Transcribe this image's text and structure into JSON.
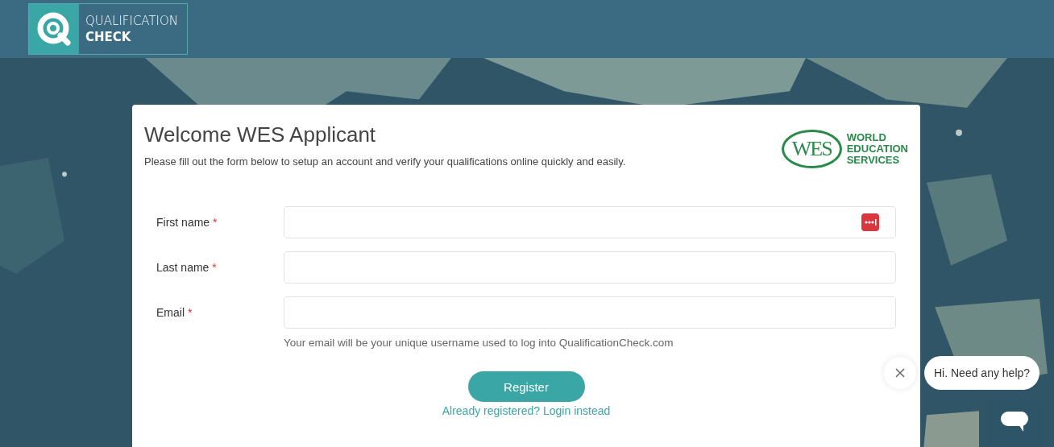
{
  "header": {
    "logo": {
      "line_1": "QUALIFICATION",
      "line_2": "CHECK"
    }
  },
  "card": {
    "title": "Welcome WES Applicant",
    "subtitle": "Please fill out the form below to setup an account and verify your qualifications online quickly and easily.",
    "partner_logo": {
      "mark": "WES",
      "lines": [
        "WORLD",
        "EDUCATION",
        "SERVICES"
      ]
    },
    "fields": [
      {
        "label": "First name",
        "required_mark": "*",
        "autofill_icon": true
      },
      {
        "label": "Last name",
        "required_mark": "*",
        "autofill_icon": false
      },
      {
        "label": "Email",
        "required_mark": "*",
        "autofill_icon": false,
        "hint": "Your email will be your unique username used to log into QualificationCheck.com"
      }
    ],
    "submit": "Register",
    "login_link": "Already registered? Login instead"
  },
  "chat": {
    "greeting": "Hi. Need any help?"
  }
}
